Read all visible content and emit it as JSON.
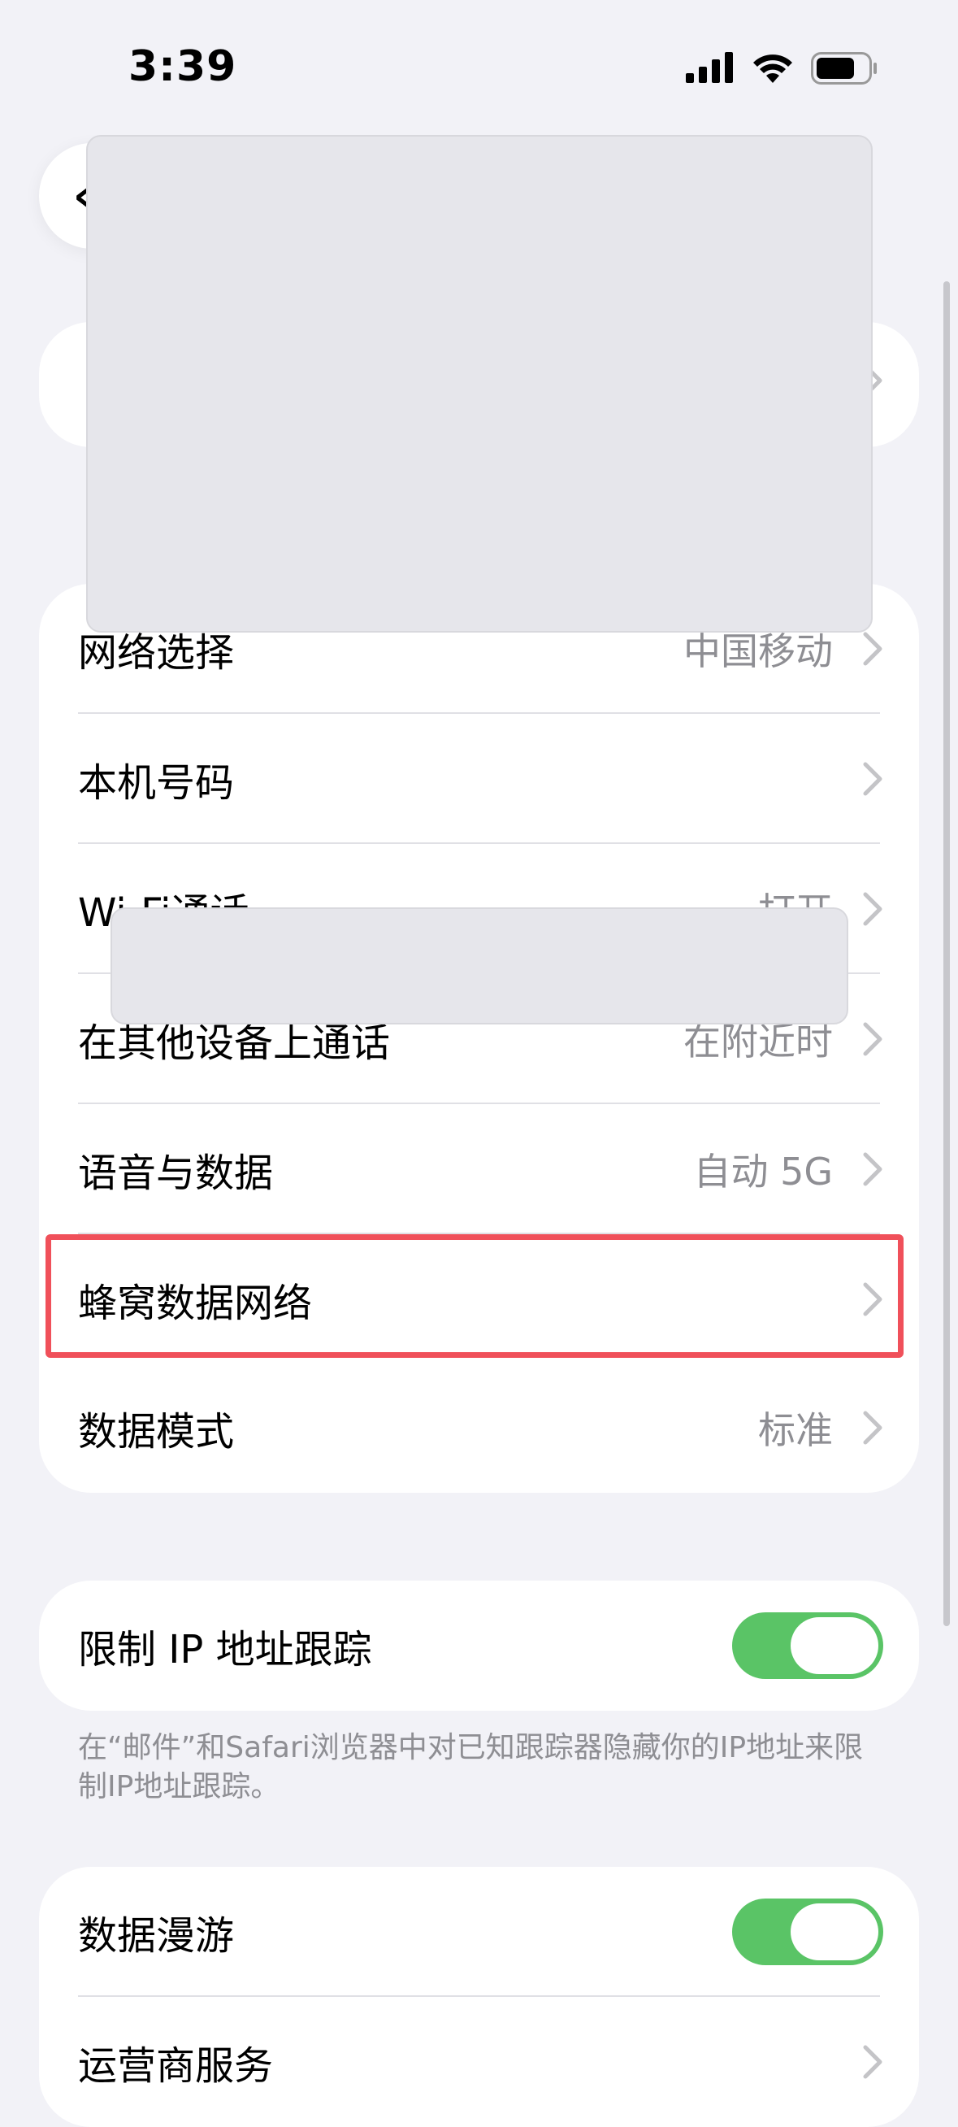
{
  "status_bar": {
    "time": "3:39"
  },
  "cellular_rows": [
    {
      "label": "网络选择",
      "value": "中国移动"
    },
    {
      "label": "本机号码",
      "value": ""
    },
    {
      "label": "Wi-Fi通话",
      "value": "打开"
    },
    {
      "label": "在其他设备上通话",
      "value": "在附近时"
    },
    {
      "label": "语音与数据",
      "value": "自动 5G"
    },
    {
      "label": "蜂窝数据网络",
      "value": ""
    },
    {
      "label": "数据模式",
      "value": "标准"
    }
  ],
  "ip_tracking": {
    "label": "限制 IP 地址跟踪",
    "toggle_on": true,
    "footnote": "在“邮件”和Safari浏览器中对已知跟踪器隐藏你的IP地址来限制IP地址跟踪。"
  },
  "roaming": {
    "label": "数据漫游",
    "toggle_on": true
  },
  "carrier_services": {
    "label": "运营商服务"
  },
  "colors": {
    "background": "#f2f2f7",
    "toggle_on": "#5ac466",
    "highlight": "#f0505a",
    "secondary_text": "#8e8e93"
  }
}
